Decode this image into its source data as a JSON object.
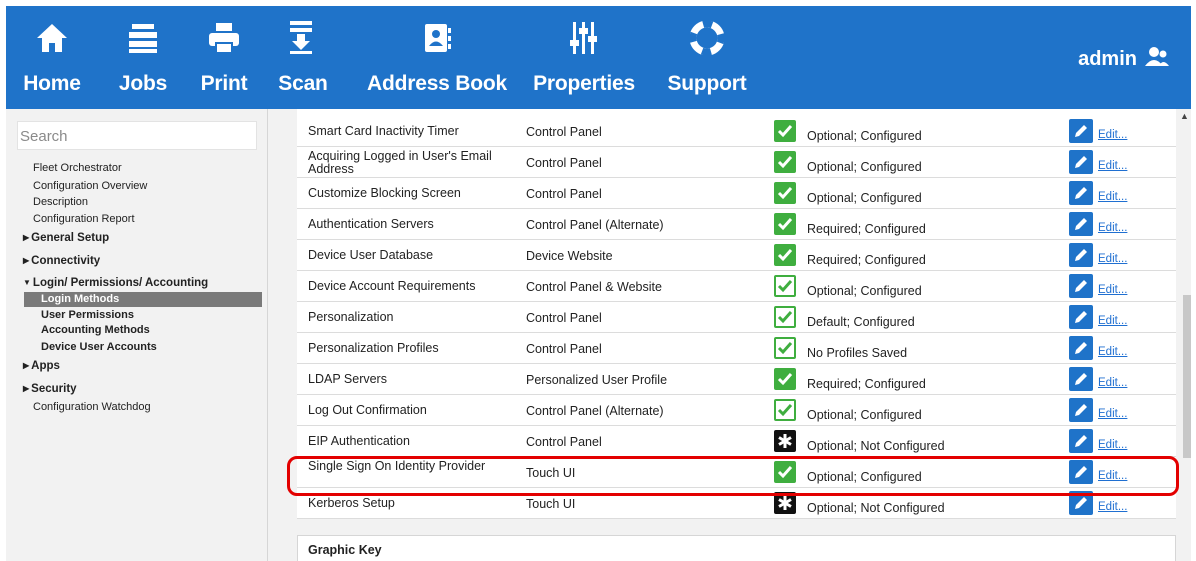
{
  "nav": {
    "home": "Home",
    "jobs": "Jobs",
    "print": "Print",
    "scan": "Scan",
    "address_book": "Address Book",
    "properties": "Properties",
    "support": "Support",
    "user": "admin"
  },
  "sidebar": {
    "search_placeholder": "Search",
    "fleet": "Fleet Orchestrator",
    "config_overview": "Configuration Overview",
    "description": "Description",
    "config_report": "Configuration Report",
    "general_setup": "General Setup",
    "connectivity": "Connectivity",
    "login_perm": "Login/ Permissions/ Accounting",
    "login_methods": "Login Methods",
    "user_permissions": "User Permissions",
    "accounting_methods": "Accounting Methods",
    "device_user_accounts": "Device User Accounts",
    "apps": "Apps",
    "security": "Security",
    "config_watchdog": "Configuration Watchdog"
  },
  "rows": [
    {
      "name": "Smart Card Inactivity Timer",
      "location": "Control Panel",
      "status": "Optional; Configured",
      "icon": "green-check"
    },
    {
      "name": "Acquiring Logged in User's Email Address",
      "location": "Control Panel",
      "status": "Optional; Configured",
      "icon": "green-check"
    },
    {
      "name": "Customize Blocking Screen",
      "location": "Control Panel",
      "status": "Optional; Configured",
      "icon": "green-check"
    },
    {
      "name": "Authentication Servers",
      "location": "Control Panel (Alternate)",
      "status": "Required; Configured",
      "icon": "green-check"
    },
    {
      "name": "Device User Database",
      "location": "Device Website",
      "status": "Required; Configured",
      "icon": "green-check"
    },
    {
      "name": "Device Account Requirements",
      "location": "Control Panel & Website",
      "status": "Optional; Configured",
      "icon": "outline-check"
    },
    {
      "name": "Personalization",
      "location": "Control Panel",
      "status": "Default; Configured",
      "icon": "outline-check"
    },
    {
      "name": "Personalization Profiles",
      "location": "Control Panel",
      "status": "No Profiles Saved",
      "icon": "outline-check"
    },
    {
      "name": "LDAP Servers",
      "location": "Personalized User Profile",
      "status": "Required; Configured",
      "icon": "green-check"
    },
    {
      "name": "Log Out Confirmation",
      "location": "Control Panel (Alternate)",
      "status": "Optional; Configured",
      "icon": "outline-check"
    },
    {
      "name": "EIP Authentication",
      "location": "Control Panel",
      "status": "Optional; Not Configured",
      "icon": "asterisk"
    },
    {
      "name": "Single Sign On Identity Provider",
      "location": "Touch UI",
      "status": "Optional; Configured",
      "icon": "green-check"
    },
    {
      "name": "Kerberos Setup",
      "location": "Touch UI",
      "status": "Optional; Not Configured",
      "icon": "asterisk"
    }
  ],
  "edit_label": "Edit...",
  "graphic_key": "Graphic Key",
  "colors": {
    "nav_blue": "#1f73c9",
    "check_green": "#3fae3f",
    "highlight_red": "#e30000"
  }
}
